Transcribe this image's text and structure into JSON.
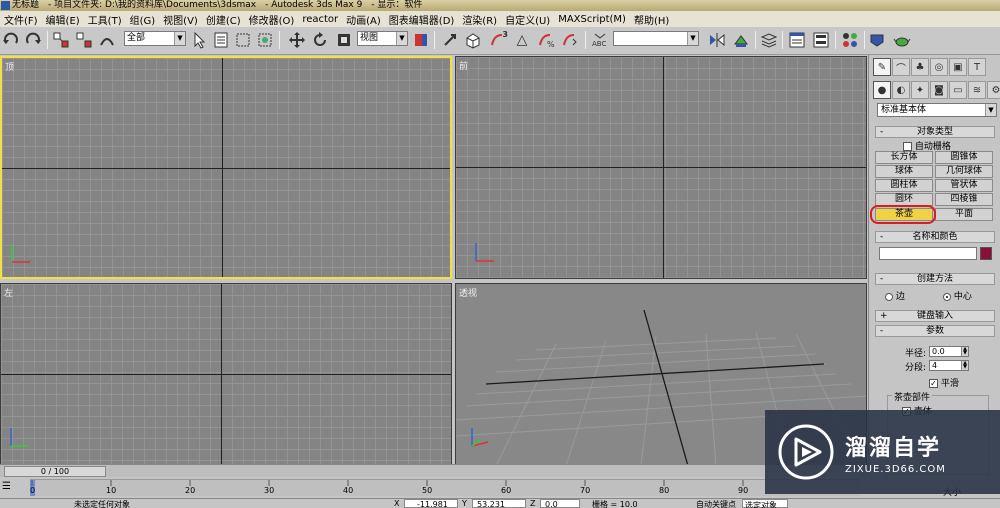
{
  "title_bar": "无标题　- 项目文件夹: D:\\我的资料库\\Documents\\3dsmax　- Autodesk 3ds Max 9　- 显示：软件",
  "menu": [
    "文件(F)",
    "编辑(E)",
    "工具(T)",
    "组(G)",
    "视图(V)",
    "创建(C)",
    "修改器(O)",
    "reactor",
    "动画(A)",
    "图表编辑器(D)",
    "渲染(R)",
    "自定义(U)",
    "MAXScript(M)",
    "帮助(H)"
  ],
  "toolbar": {
    "selection_filter": "全部",
    "reference_coord": "视图",
    "named_selection": "",
    "snap_icons": [
      "3",
      "△"
    ]
  },
  "viewports": {
    "top": "顶",
    "front": "前",
    "left": "左",
    "perspective": "透视"
  },
  "command_panel": {
    "category_dropdown": "标准基本体",
    "object_type_title": "对象类型",
    "autogrid_label": "自动栅格",
    "primitives": [
      "长方体",
      "圆锥体",
      "球体",
      "几何球体",
      "圆柱体",
      "管状体",
      "圆环",
      "四棱锥",
      "茶壶",
      "平面"
    ],
    "selected_primitive": "茶壶",
    "name_color_title": "名称和颜色",
    "object_color": "#8b0f3a",
    "creation_method_title": "创建方法",
    "creation_options": [
      "边",
      "中心"
    ],
    "creation_selected": "中心",
    "keyboard_entry_title": "键盘输入",
    "params_title": "参数",
    "radius_label": "半径:",
    "radius_value": "0.0",
    "segments_label": "分段:",
    "segments_value": "4",
    "smooth_label": "平滑",
    "teapot_parts_label": "茶壶部件",
    "part_visible_partial": "壶体",
    "bottom_partial": "大小"
  },
  "timeline": {
    "frame_display": "0 / 100",
    "ticks": [
      "0",
      "10",
      "20",
      "30",
      "40",
      "50",
      "60",
      "70",
      "80",
      "90"
    ]
  },
  "status": {
    "prompt": "未选定任何对象",
    "x": "-11.981",
    "y": "53.231",
    "z": "0.0",
    "grid": "栅格 = 10.0",
    "auto_key": "自动关键点",
    "selected_set": "选定对象"
  },
  "watermark": {
    "brand": "溜溜自学",
    "url": "ZIXUE.3D66.COM"
  }
}
